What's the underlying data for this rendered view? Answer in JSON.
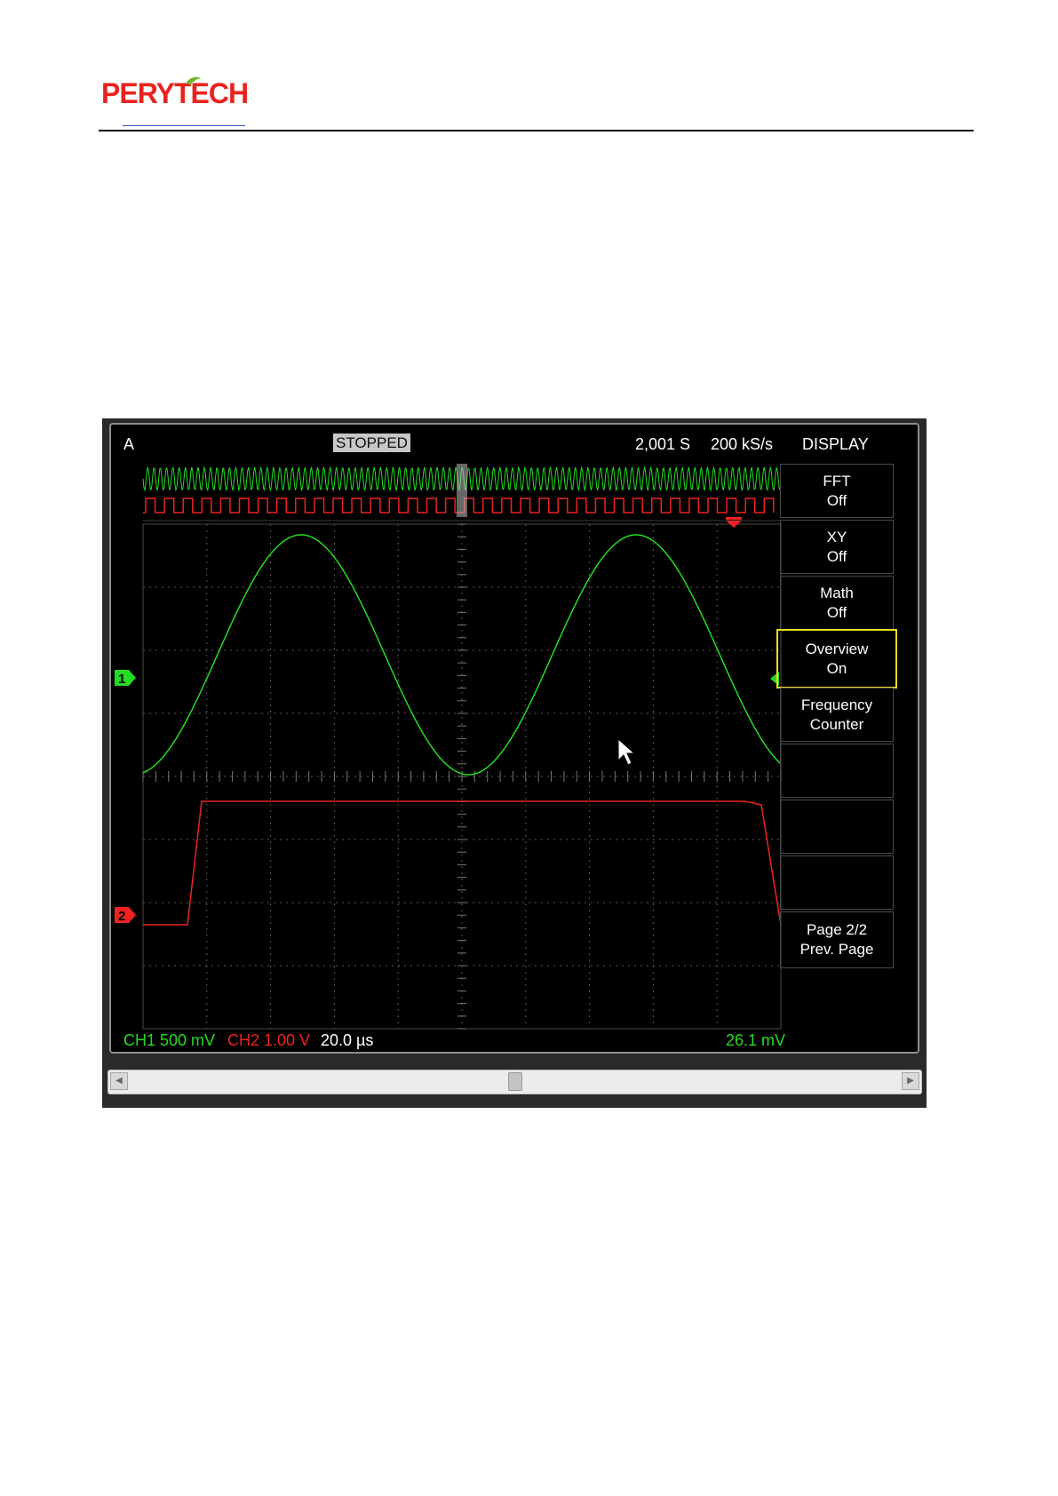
{
  "header": {
    "logo_text": "PERYTECH",
    "brand_color": "#e8231e",
    "leaf_color": "#6fb72b"
  },
  "scope": {
    "mode": "A",
    "run_state": "STOPPED",
    "samples": "2,001 S",
    "sample_rate": "200 kS/s",
    "menu_title": "DISPLAY",
    "menu_items": [
      {
        "line1": "FFT",
        "line2": "Off"
      },
      {
        "line1": "XY",
        "line2": "Off"
      },
      {
        "line1": "Math",
        "line2": "Off"
      },
      {
        "line1": "Overview",
        "line2": "On"
      },
      {
        "line1": "Frequency",
        "line2": "Counter"
      },
      {
        "line1": "",
        "line2": ""
      },
      {
        "line1": "",
        "line2": ""
      },
      {
        "line1": "",
        "line2": ""
      },
      {
        "line1": "Page 2/2",
        "line2": "Prev. Page"
      }
    ],
    "selected_menu_item": "Overview",
    "ch1_marker": "1",
    "ch2_marker": "2",
    "ch1_scale": "CH1 500 mV",
    "ch2_scale": "CH2 1.00 V",
    "timebase": "20.0 µs",
    "trigger_level": "26.1 mV",
    "colors": {
      "ch1": "#22dd22",
      "ch2": "#ee2222",
      "grid": "#5a5a5a",
      "highlight": "#f0dc22",
      "background": "#000000"
    },
    "icons": [
      "cursor-arrow-icon",
      "trigger-position-icon",
      "trigger-level-icon",
      "scroll-left-icon",
      "scroll-right-icon"
    ]
  }
}
